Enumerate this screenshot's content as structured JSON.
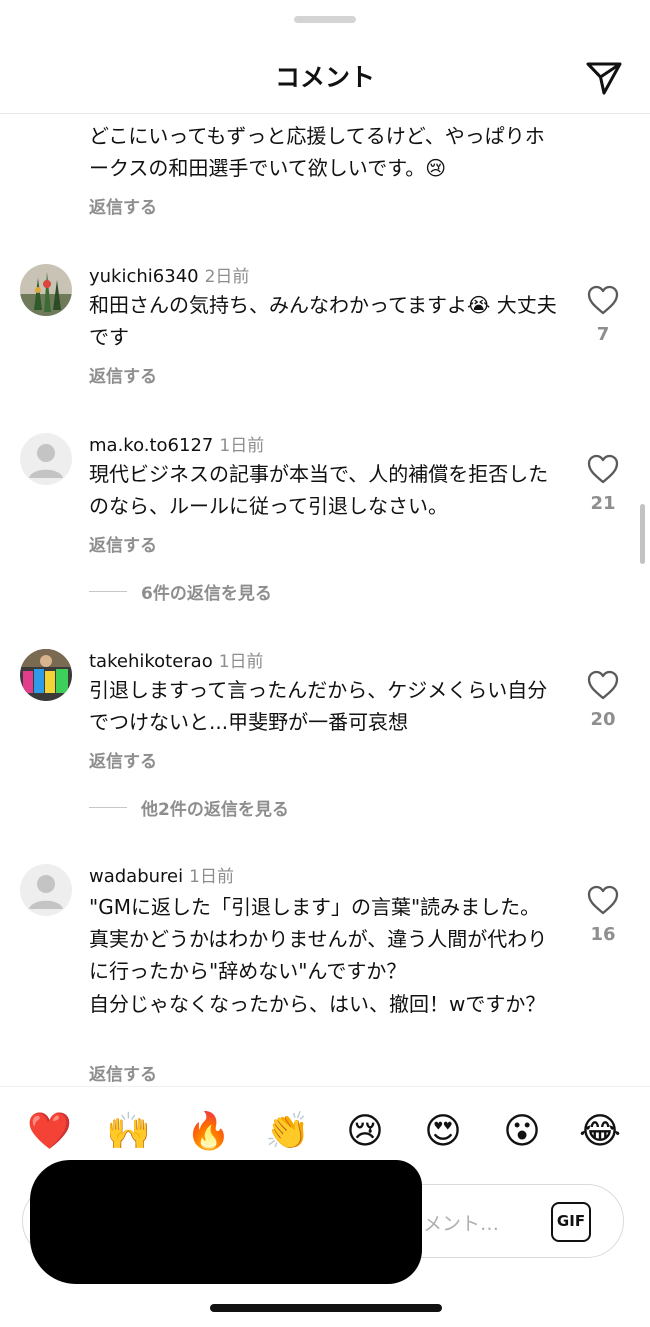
{
  "header": {
    "title": "コメント",
    "share_icon": "paper-plane-icon"
  },
  "comments": [
    {
      "username": "",
      "time": "",
      "text": "どこにいってもずっと応援してるけど、やっぱりホークスの和田選手でいて欲しいです。😢",
      "reply_label": "返信する",
      "likes": ""
    },
    {
      "username": "yukichi6340",
      "time": "2日前",
      "text": "和田さんの気持ち、みんなわかってますよ😭 大丈夫です",
      "reply_label": "返信する",
      "likes": "7"
    },
    {
      "username": "ma.ko.to6127",
      "time": "1日前",
      "text": "現代ビジネスの記事が本当で、人的補償を拒否したのなら、ルールに従って引退しなさい。",
      "reply_label": "返信する",
      "likes": "21",
      "view_replies": "6件の返信を見る"
    },
    {
      "username": "takehikoterao",
      "time": "1日前",
      "text": "引退しますって言ったんだから、ケジメくらい自分でつけないと...甲斐野が一番可哀想",
      "reply_label": "返信する",
      "likes": "20",
      "view_replies": "他2件の返信を見る"
    },
    {
      "username": "wadaburei",
      "time": "1日前",
      "text": "\"GMに返した「引退します」の言葉\"読みました。真実かどうかはわかりませんが、違う人間が代わりに行ったから\"辞めない\"んですか？",
      "text2": "自分じゃなくなったから、はい、撤回！wですか？",
      "reply_label": "返信する",
      "likes": "16"
    }
  ],
  "emoji_bar": [
    "❤️",
    "🙌",
    "🔥",
    "👏",
    "😢",
    "😍",
    "😮",
    "😂"
  ],
  "input": {
    "placeholder_visible": "メント…",
    "gif_label": "GIF"
  },
  "colors": {
    "text": "#111111",
    "muted": "#8e8e8e",
    "divider": "#e6e6e6"
  }
}
